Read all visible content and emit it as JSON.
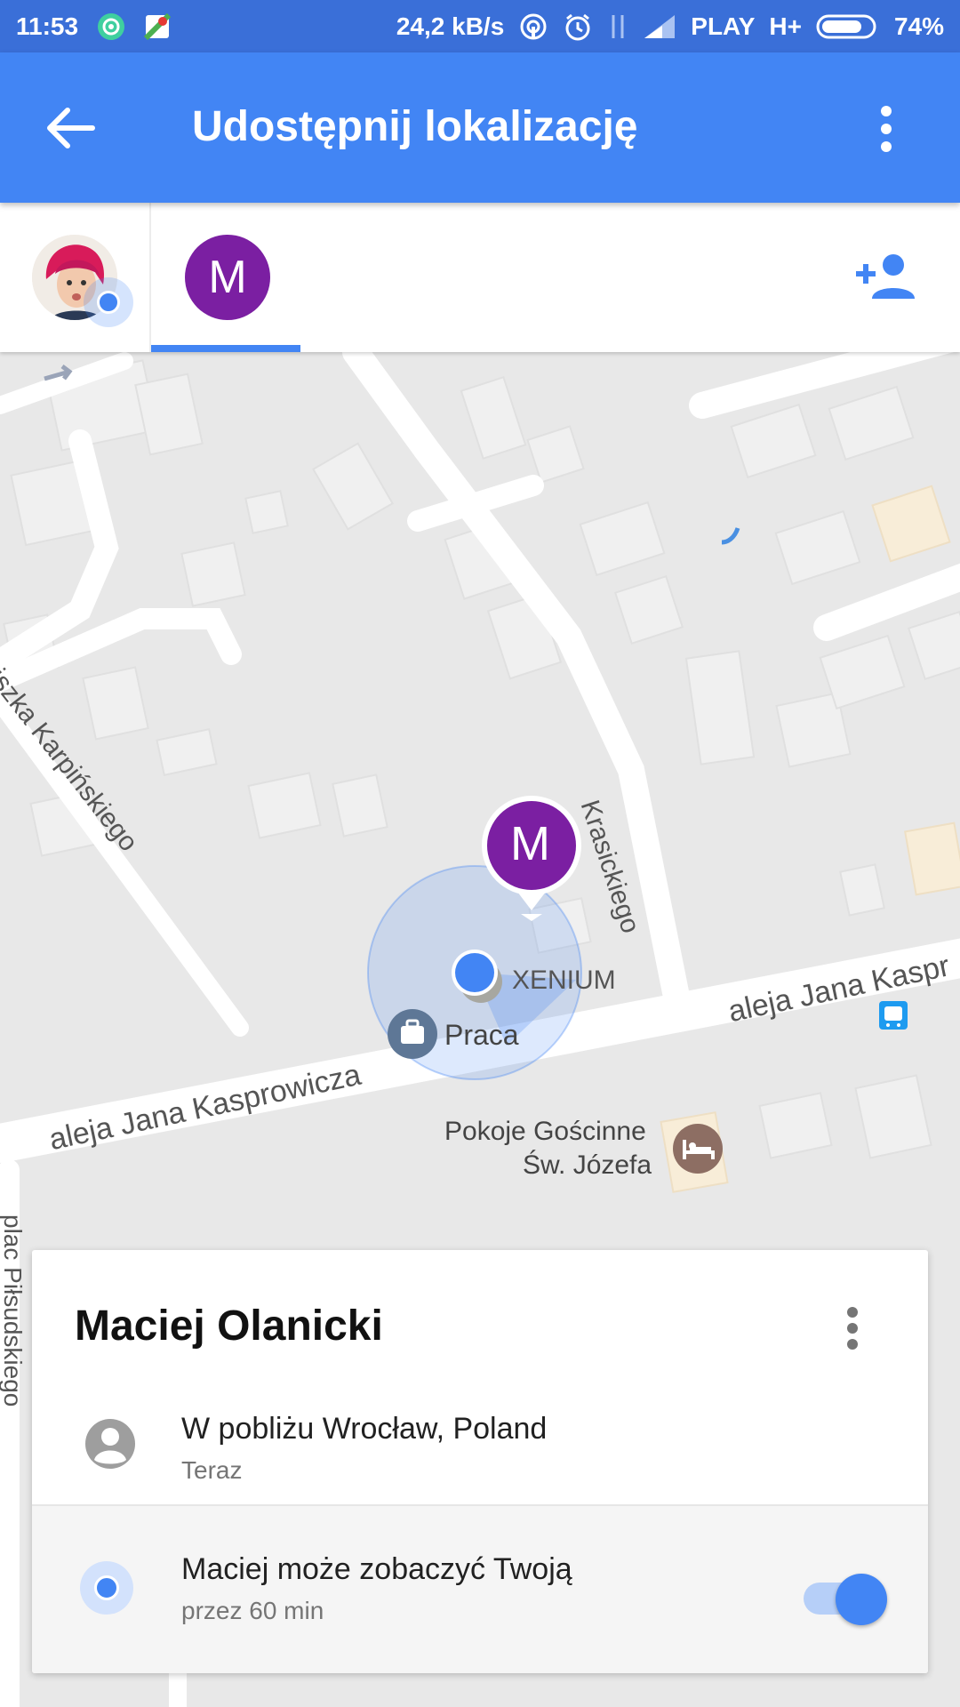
{
  "status_bar": {
    "time": "11:53",
    "speed": "24,2 kB/s",
    "carrier": "PLAY",
    "network": "H+",
    "battery": "74%",
    "icons": [
      "vpn-icon",
      "maps-notification-icon",
      "hotspot-icon",
      "alarm-icon",
      "data-arrows-icon",
      "signal-icon",
      "battery-icon"
    ]
  },
  "app_bar": {
    "title": "Udostępnij lokalizację",
    "back_icon": "arrow-back-icon",
    "overflow_icon": "more-vert-icon"
  },
  "people_tabs": {
    "self_avatar": "user-photo-avatar",
    "tabs": [
      {
        "initial": "M",
        "color": "#7b1fa2",
        "selected": true
      }
    ],
    "add_icon": "person-add-icon",
    "accent": "#4285f4"
  },
  "map": {
    "streets": [
      "Krasickiego",
      "aleja Jana Kasprowicza",
      "aleja Jana Kaspr",
      "Franciszka Karpińskiego",
      "plac Piłsudskiego"
    ],
    "places": [
      {
        "name": "XENIUM"
      },
      {
        "name": "Praca",
        "icon": "briefcase-icon"
      },
      {
        "name": "Pokoje Gościnne",
        "name2": "Św. Józefa",
        "icon": "hotel-bed-icon"
      }
    ],
    "marker_initial": "M",
    "bus_stop_icon": "bus-icon"
  },
  "card": {
    "name": "Maciej Olanicki",
    "location": "W pobliżu Wrocław, Poland",
    "time": "Teraz",
    "share_text": "Maciej może zobaczyć Twoją",
    "share_duration": "przez 60 min",
    "toggle_on": true
  }
}
